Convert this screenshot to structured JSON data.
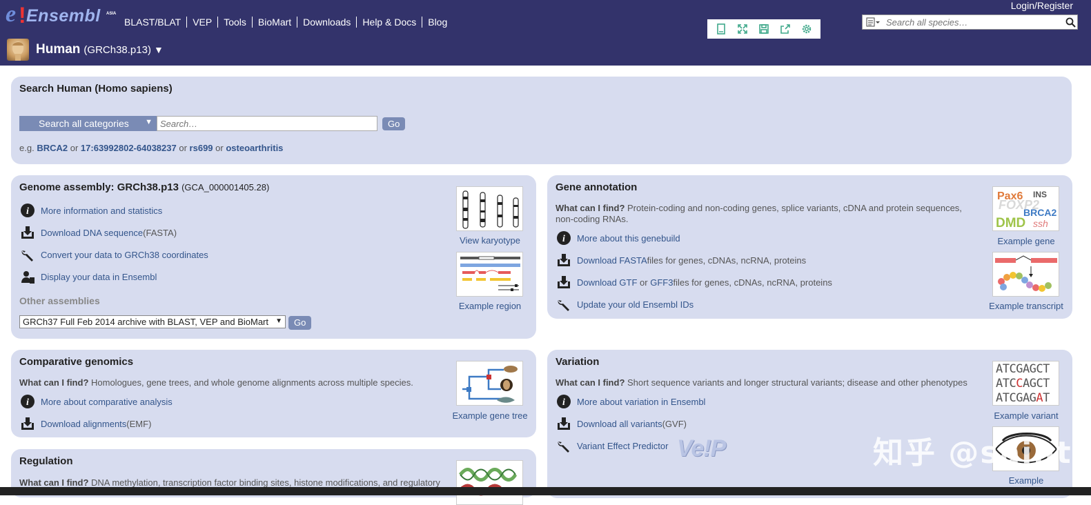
{
  "logo": {
    "e": "e",
    "bang": "!",
    "word": "Ensembl",
    "suffix": "ASIA"
  },
  "nav": [
    "BLAST/BLAT",
    "VEP",
    "Tools",
    "BioMart",
    "Downloads",
    "Help & Docs",
    "Blog"
  ],
  "login": "Login/Register",
  "species_search": {
    "placeholder": "Search all species…"
  },
  "species": {
    "name": "Human",
    "assembly": "(GRCh38.p13)",
    "caret": "▼"
  },
  "search_panel": {
    "title": "Search Human (Homo sapiens)",
    "category": "Search all categories",
    "placeholder": "Search…",
    "go": "Go",
    "eg_prefix": "e.g.",
    "examples": [
      "BRCA2",
      "17:63992802-64038237",
      "rs699",
      "osteoarthritis"
    ],
    "or": "or"
  },
  "genome_assembly": {
    "title": "Genome assembly: GRCh38.p13",
    "accession": "(GCA_000001405.28)",
    "items": [
      {
        "link": "More information and statistics",
        "rest": ""
      },
      {
        "link": "Download DNA sequence",
        "rest": " (FASTA)"
      },
      {
        "link": "Convert your data to GRCh38 coordinates",
        "rest": ""
      },
      {
        "link": "Display your data in Ensembl",
        "rest": ""
      }
    ],
    "other_assemblies": "Other assemblies",
    "assembly_option": "GRCh37 Full Feb 2014 archive with BLAST, VEP and BioMart",
    "go": "Go",
    "thumb1": "View karyotype",
    "thumb2": "Example region"
  },
  "gene_annotation": {
    "title": "Gene annotation",
    "find_label": "What can I find?",
    "find_text": " Protein-coding and non-coding genes, splice variants, cDNA and protein sequences, non-coding RNAs.",
    "items": [
      {
        "link": "More about this genebuild",
        "mid": "",
        "link2": "",
        "rest": ""
      },
      {
        "link": "Download FASTA",
        "mid": "",
        "link2": "",
        "rest": " files for genes, cDNAs, ncRNA, proteins"
      },
      {
        "link": "Download GTF",
        "mid": " or ",
        "link2": "GFF3",
        "rest": " files for genes, cDNAs, ncRNA, proteins"
      },
      {
        "link": "Update your old Ensembl IDs",
        "mid": "",
        "link2": "",
        "rest": ""
      }
    ],
    "thumb1": "Example gene",
    "thumb2": "Example transcript",
    "gene_words": {
      "pax6": "Pax6",
      "ins": "INS",
      "foxp2": "FOXP2",
      "brca2": "BRCA2",
      "dmd": "DMD",
      "ssh": "ssh"
    }
  },
  "comparative": {
    "title": "Comparative genomics",
    "find_label": "What can I find?",
    "find_text": " Homologues, gene trees, and whole genome alignments across multiple species.",
    "items": [
      {
        "link": "More about comparative analysis",
        "rest": ""
      },
      {
        "link": "Download alignments",
        "rest": " (EMF)"
      }
    ],
    "thumb": "Example gene tree"
  },
  "variation": {
    "title": "Variation",
    "find_label": "What can I find?",
    "find_text": " Short sequence variants and longer structural variants; disease and other phenotypes",
    "items": [
      {
        "link": "More about variation in Ensembl",
        "rest": ""
      },
      {
        "link": "Download all variants",
        "rest": " (GVF)"
      },
      {
        "link": "Variant Effect Predictor",
        "rest": ""
      }
    ],
    "thumb": "Example variant",
    "thumb2": "Example",
    "seq_rows": [
      {
        "a": "ATCGAGCT",
        "b": "",
        "c": ""
      },
      {
        "a": "ATC",
        "b": "C",
        "c": "AGCT"
      },
      {
        "a": "ATCGAG",
        "b": "A",
        "c": "T"
      }
    ],
    "vep_logo": "Ve!P"
  },
  "regulation": {
    "title": "Regulation",
    "find_label": "What can I find?",
    "find_text": " DNA methylation, transcription factor binding sites, histone modifications, and regulatory"
  },
  "watermark": "知乎 @saint",
  "colors": {
    "masthead": "#33336b",
    "panel": "#d7dcef",
    "link": "#33558b",
    "button": "#7a8bb5"
  }
}
